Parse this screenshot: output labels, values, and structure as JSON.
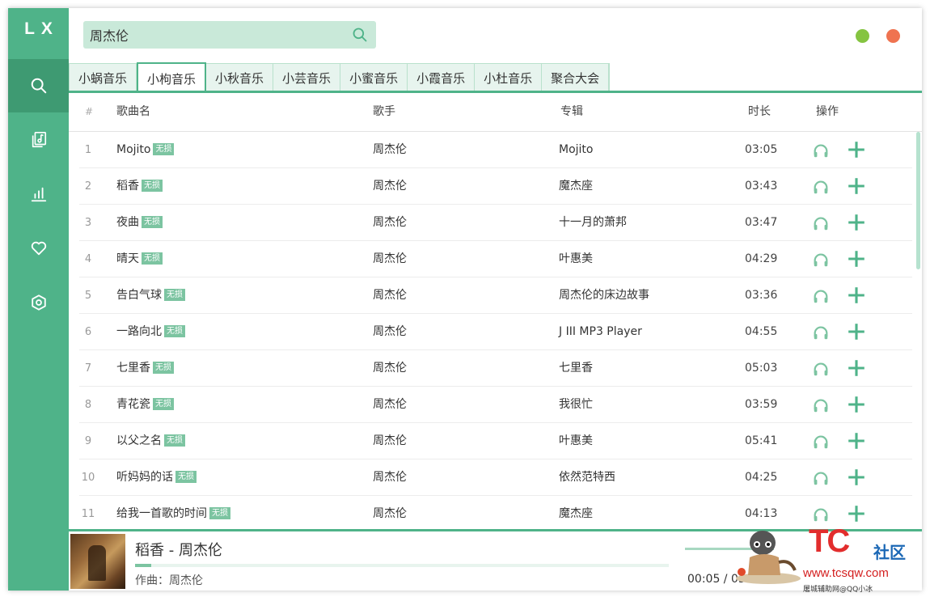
{
  "app": {
    "logo": "LX"
  },
  "sidebar": {
    "items": [
      {
        "icon": "search-icon",
        "active": true
      },
      {
        "icon": "music-file-icon",
        "active": false
      },
      {
        "icon": "bar-chart-icon",
        "active": false
      },
      {
        "icon": "heart-icon",
        "active": false
      },
      {
        "icon": "settings-icon",
        "active": false
      }
    ]
  },
  "search": {
    "value": "周杰伦",
    "icon": "search-icon"
  },
  "window": {
    "minimize_color": "#85c441",
    "close_color": "#ef7350"
  },
  "tabs": [
    {
      "label": "小蜗音乐",
      "active": false
    },
    {
      "label": "小枸音乐",
      "active": true
    },
    {
      "label": "小秋音乐",
      "active": false
    },
    {
      "label": "小芸音乐",
      "active": false
    },
    {
      "label": "小蜜音乐",
      "active": false
    },
    {
      "label": "小霞音乐",
      "active": false
    },
    {
      "label": "小杜音乐",
      "active": false
    },
    {
      "label": "聚合大会",
      "active": false
    }
  ],
  "table": {
    "headers": {
      "num": "#",
      "name": "歌曲名",
      "artist": "歌手",
      "album": "专辑",
      "duration": "时长",
      "actions": "操作"
    },
    "badge": "无损",
    "rows": [
      {
        "num": "1",
        "name": "Mojito",
        "artist": "周杰伦",
        "album": "Mojito",
        "duration": "03:05"
      },
      {
        "num": "2",
        "name": "稻香",
        "artist": "周杰伦",
        "album": "魔杰座",
        "duration": "03:43"
      },
      {
        "num": "3",
        "name": "夜曲",
        "artist": "周杰伦",
        "album": "十一月的萧邦",
        "duration": "03:47"
      },
      {
        "num": "4",
        "name": "晴天",
        "artist": "周杰伦",
        "album": "叶惠美",
        "duration": "04:29"
      },
      {
        "num": "5",
        "name": "告白气球",
        "artist": "周杰伦",
        "album": "周杰伦的床边故事",
        "duration": "03:36"
      },
      {
        "num": "6",
        "name": "一路向北",
        "artist": "周杰伦",
        "album": "J III MP3 Player",
        "duration": "04:55"
      },
      {
        "num": "7",
        "name": "七里香",
        "artist": "周杰伦",
        "album": "七里香",
        "duration": "05:03"
      },
      {
        "num": "8",
        "name": "青花瓷",
        "artist": "周杰伦",
        "album": "我很忙",
        "duration": "03:59"
      },
      {
        "num": "9",
        "name": "以父之名",
        "artist": "周杰伦",
        "album": "叶惠美",
        "duration": "05:41"
      },
      {
        "num": "10",
        "name": "听妈妈的话",
        "artist": "周杰伦",
        "album": "依然范特西",
        "duration": "04:25"
      },
      {
        "num": "11",
        "name": "给我一首歌的时间",
        "artist": "周杰伦",
        "album": "魔杰座",
        "duration": "04:13"
      }
    ]
  },
  "player": {
    "title": "稻香 - 周杰伦",
    "author": "作曲：周杰伦",
    "time": "00:05 / 03:43",
    "progress": 0.03,
    "accent": "#4fb389"
  },
  "watermark": {
    "brand": "TC",
    "community": "社区",
    "url": "www.tcsqw.com",
    "small": "屠城辅助网@QQ小冰"
  }
}
